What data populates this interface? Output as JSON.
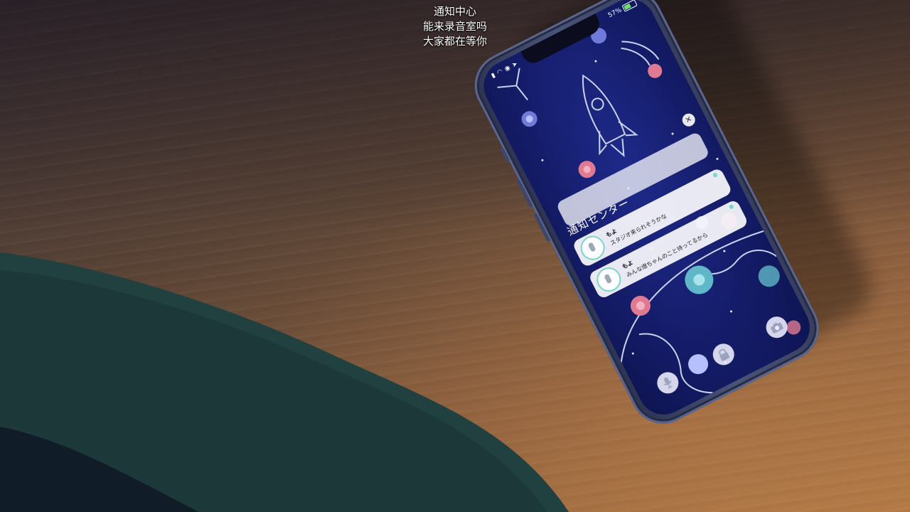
{
  "subtitle": {
    "line1": "通知中心",
    "line2": "能来录音室吗",
    "line3": "大家都在等你"
  },
  "phone": {
    "status": {
      "battery_text": "57%",
      "battery_level": 0.57
    },
    "notification_center": {
      "title": "通知センター",
      "notifications": [
        {
          "sender": "もよ",
          "message": "スタジオ来られそうかな"
        },
        {
          "sender": "もよ",
          "message": "みんな燈ちゃんのこと待ってるから"
        }
      ]
    },
    "icons": [
      "signal-icon",
      "wifi-icon",
      "alarm-icon",
      "location-icon",
      "close-icon",
      "mic-icon",
      "lock-icon",
      "camera-icon",
      "rocket-icon"
    ]
  },
  "colors": {
    "screen_blue": "#151d6b",
    "accent_teal": "#7bd6c9",
    "flower_pink": "#e07a92",
    "table_wood": "#8a5e3e",
    "sleeve_green": "#1d3a3a"
  }
}
